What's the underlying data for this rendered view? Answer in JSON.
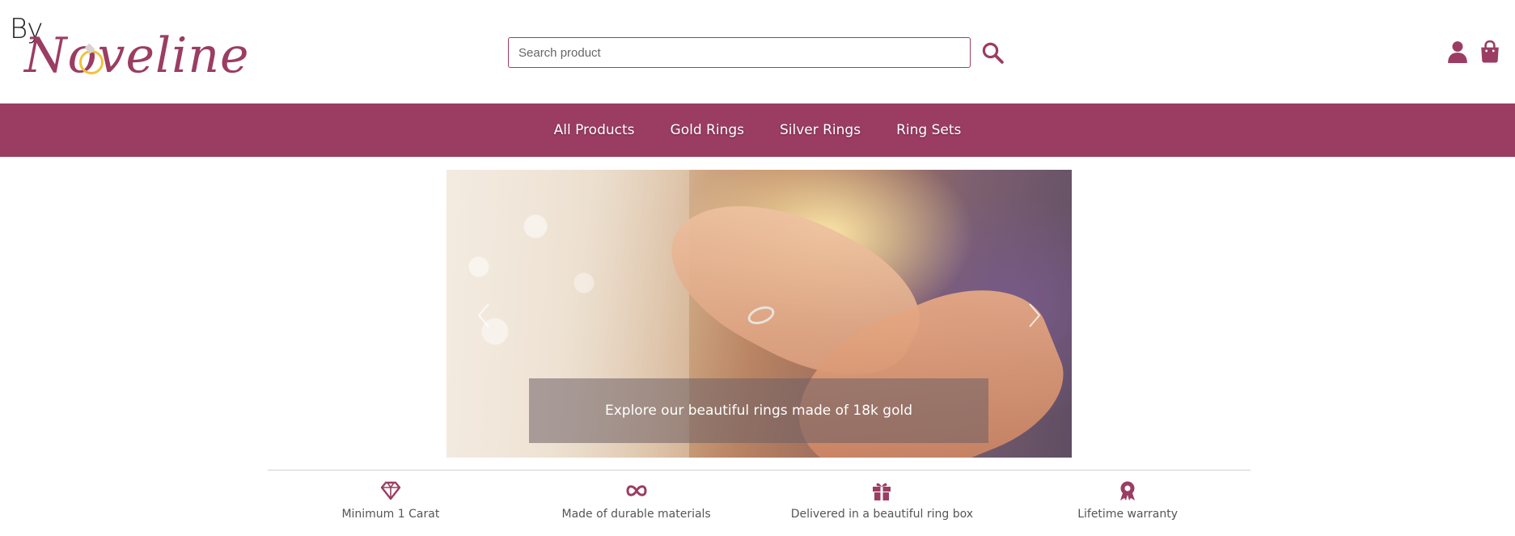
{
  "brand": {
    "by": "By",
    "name": "Noveline",
    "color": "#9b3d63",
    "ring_color": "#f0c33c"
  },
  "search": {
    "placeholder": "Search product",
    "value": ""
  },
  "header_icons": [
    "user-icon",
    "shopping-bag-icon"
  ],
  "nav": {
    "items": [
      {
        "label": "All Products"
      },
      {
        "label": "Gold Rings"
      },
      {
        "label": "Silver Rings"
      },
      {
        "label": "Ring Sets"
      }
    ]
  },
  "carousel": {
    "caption": "Explore our beautiful rings made of 18k gold",
    "prev_icon": "chevron-left-icon",
    "next_icon": "chevron-right-icon"
  },
  "features": [
    {
      "icon": "diamond-icon",
      "label": "Minimum 1 Carat"
    },
    {
      "icon": "infinity-icon",
      "label": "Made of durable materials"
    },
    {
      "icon": "gift-icon",
      "label": "Delivered in a beautiful ring box"
    },
    {
      "icon": "award-ribbon-icon",
      "label": "Lifetime warranty"
    }
  ]
}
